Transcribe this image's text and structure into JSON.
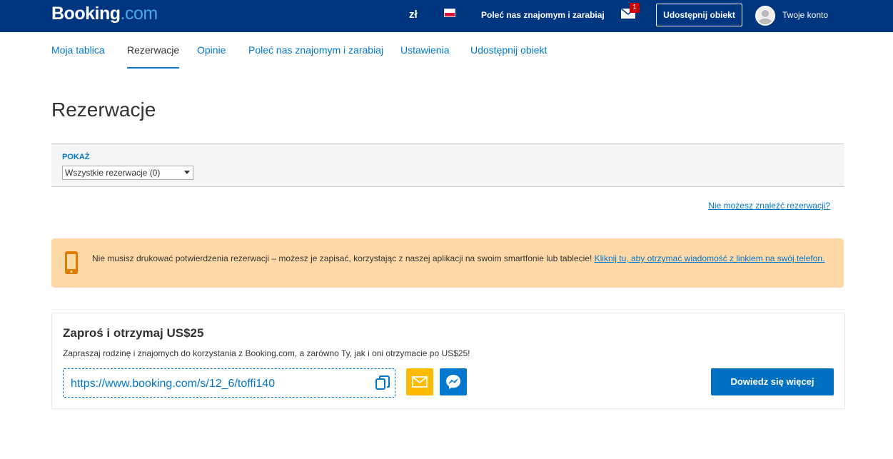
{
  "header": {
    "logo_main": "Booking",
    "logo_suffix": ".com",
    "currency": "zł",
    "refer_link": "Poleć nas znajomym i zarabiaj",
    "mail_badge": "1",
    "list_property": "Udostępnij obiekt",
    "account": "Twoje konto"
  },
  "subnav": {
    "tabs": [
      {
        "label": "Moja tablica"
      },
      {
        "label": "Rezerwacje"
      },
      {
        "label": "Opinie"
      },
      {
        "label": "Poleć nas znajomym i zarabiaj"
      },
      {
        "label": "Ustawienia"
      },
      {
        "label": "Udostępnij obiekt"
      }
    ],
    "active": "Rezerwacje"
  },
  "page_title": "Rezerwacje",
  "filter": {
    "label": "POKAŻ",
    "selected": "Wszystkie rezerwacje (0)"
  },
  "cant_find_link": "Nie możesz znaleźć rezerwacji?",
  "notice": {
    "text": "Nie musisz drukować potwierdzenia rezerwacji – możesz je zapisać, korzystając z naszej aplikacji na swoim smartfonie lub tablecie! ",
    "link": "Kliknij tu, aby otrzymać wiadomość z linkiem na swój telefon."
  },
  "invite": {
    "title": "Zaproś i otrzymaj US$25",
    "description": "Zapraszaj rodzinę i znajomych do korzystania z Booking.com, a zarówno Ty, jak i oni otrzymacie po US$25!",
    "link": "https://www.booking.com/s/12_6/toffi140",
    "learn_more": "Dowiedz się więcej"
  },
  "icons": {
    "mail": "envelope-icon",
    "copy": "copy-icon",
    "share_email": "email-share-icon",
    "share_messenger": "messenger-icon",
    "phone": "smartphone-icon"
  },
  "colors": {
    "brand": "#003580",
    "link": "#0077cc",
    "notice_bg": "#fed8a7",
    "cta": "#0071c2",
    "email_share": "#febb02"
  }
}
